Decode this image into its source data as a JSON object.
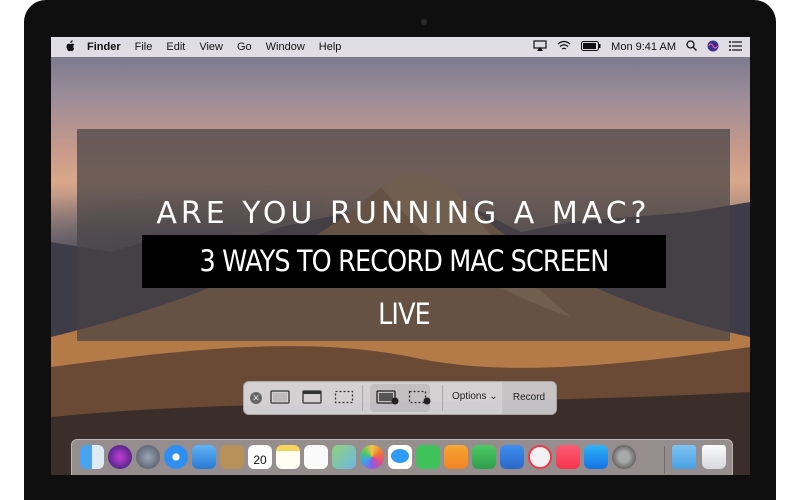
{
  "menubar": {
    "apple": "",
    "app_name": "Finder",
    "menus": [
      "File",
      "Edit",
      "View",
      "Go",
      "Window",
      "Help"
    ],
    "clock": "Mon 9:41 AM"
  },
  "banner": {
    "headline": "ARE YOU RUNNING A MAC?",
    "subheadline": "3 WAYS TO RECORD MAC SCREEN LIVE"
  },
  "capture_toolbar": {
    "close_symbol": "✕",
    "options_label": "Options",
    "options_chevron": "⌄",
    "record_label": "Record"
  },
  "dock": {
    "calendar_month": "JUL",
    "calendar_day": "20",
    "icons": [
      "finder-icon",
      "siri-icon",
      "launchpad-icon",
      "safari-icon",
      "mail-icon",
      "contacts-icon",
      "calendar-icon",
      "notes-icon",
      "reminders-icon",
      "maps-icon",
      "photos-icon",
      "messages-icon",
      "facetime-icon",
      "pages-icon",
      "numbers-icon",
      "keynote-icon",
      "news-icon",
      "music-icon",
      "app-store-icon",
      "system-preferences-icon",
      "downloads-folder-icon",
      "trash-icon"
    ]
  }
}
